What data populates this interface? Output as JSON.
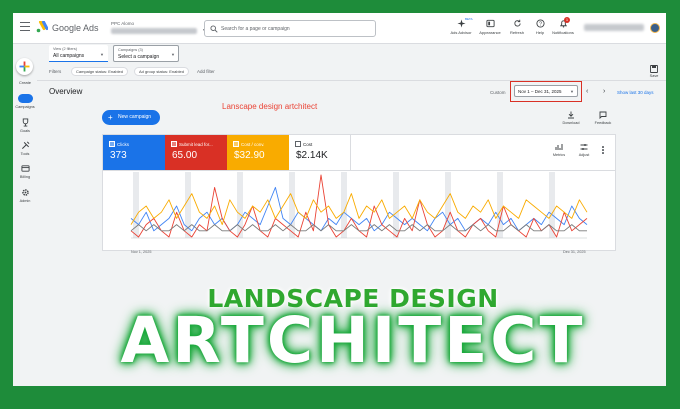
{
  "app": {
    "name": "Google Ads",
    "account_label": "PPC Alomo",
    "search_placeholder": "Search for a page or campaign"
  },
  "toolbar": {
    "tools": [
      {
        "label": "Ads Advisor",
        "icon": "sparkle-icon",
        "badge": "BETA"
      },
      {
        "label": "Appearance",
        "icon": "appearance-icon"
      },
      {
        "label": "Refresh",
        "icon": "refresh-icon"
      },
      {
        "label": "Help",
        "icon": "help-icon"
      },
      {
        "label": "Notifications",
        "icon": "bell-icon",
        "badge": "1"
      }
    ]
  },
  "sidebar": {
    "create_label": "Create",
    "items": [
      {
        "label": "Campaigns",
        "icon": "campaigns-icon",
        "active": true
      },
      {
        "label": "Goals",
        "icon": "trophy-icon"
      },
      {
        "label": "Tools",
        "icon": "tools-icon"
      },
      {
        "label": "Billing",
        "icon": "billing-icon"
      },
      {
        "label": "Admin",
        "icon": "gear-icon"
      }
    ]
  },
  "filters": {
    "view_small": "View (2 filters)",
    "view_value": "All campaigns",
    "campaigns_small": "Campaigns (3)",
    "campaigns_value": "Select a campaign",
    "label": "Filters",
    "chips": [
      "Campaign status: Enabled",
      "Ad group status: Enabled"
    ],
    "add_filter": "Add filter",
    "save_label": "Save"
  },
  "overview": {
    "title": "Overview",
    "custom_label": "Custom",
    "date_range": "Nov 1 – Dec 31, 2025",
    "show_last": "Show last 30 days",
    "caption": "Lanscape design artchitect",
    "new_campaign": "New campaign",
    "download": "Download",
    "feedback": "Feedback"
  },
  "metrics": [
    {
      "title": "Clicks",
      "value": "373",
      "color": "#1a73e8"
    },
    {
      "title": "Submit lead for...",
      "value": "65.00",
      "color": "#d93025"
    },
    {
      "title": "Cost / conv.",
      "value": "$32.90",
      "color": "#f9ab00"
    },
    {
      "title": "Cost",
      "value": "$2.14K",
      "color": "#ffffff"
    }
  ],
  "card_tools": {
    "metrics": "Metrics",
    "adjust": "Adjust"
  },
  "chart_data": {
    "type": "line",
    "xlabel_start": "Nov 1, 2025",
    "xlabel_end": "Dec 31, 2025",
    "series": [
      {
        "color": "#4285f4",
        "values": [
          3,
          2,
          4,
          1,
          2,
          3,
          5,
          2,
          1,
          3,
          4,
          2,
          3,
          1,
          2,
          4,
          3,
          2,
          5,
          8,
          3,
          2,
          4,
          3,
          2,
          1,
          3,
          2,
          4,
          3,
          2,
          3,
          1,
          2,
          4,
          3,
          2,
          3,
          2,
          1,
          3,
          4,
          2,
          3,
          1,
          2,
          3,
          2,
          4,
          2,
          3,
          1,
          2,
          3,
          2,
          4,
          3,
          2,
          5,
          3,
          2
        ]
      },
      {
        "color": "#ea4335",
        "values": [
          1,
          0,
          2,
          3,
          1,
          0,
          4,
          1,
          0,
          2,
          1,
          8,
          3,
          1,
          0,
          2,
          5,
          1,
          0,
          3,
          2,
          1,
          0,
          4,
          1,
          10,
          2,
          0,
          1,
          3,
          1,
          0,
          5,
          2,
          1,
          0,
          3,
          1,
          6,
          2,
          0,
          1,
          4,
          1,
          0,
          2,
          3,
          1,
          0,
          5,
          2,
          1,
          0,
          3,
          1,
          2,
          0,
          4,
          1,
          2,
          3
        ]
      },
      {
        "color": "#f9ab00",
        "values": [
          2,
          4,
          5,
          3,
          4,
          6,
          3,
          5,
          7,
          4,
          3,
          5,
          2,
          6,
          4,
          3,
          5,
          4,
          6,
          3,
          5,
          7,
          4,
          3,
          6,
          4,
          5,
          3,
          4,
          7,
          3,
          5,
          4,
          6,
          3,
          4,
          5,
          3,
          6,
          4,
          3,
          5,
          7,
          4,
          3,
          5,
          4,
          6,
          3,
          5,
          4,
          3,
          6,
          5,
          4,
          3,
          5,
          4,
          3,
          6,
          4
        ]
      },
      {
        "color": "#7a7a7a",
        "values": [
          1,
          2,
          1,
          2,
          1,
          1,
          2,
          1,
          2,
          1,
          1,
          2,
          1,
          1,
          2,
          1,
          2,
          1,
          1,
          2,
          1,
          2,
          1,
          1,
          2,
          1,
          2,
          1,
          1,
          2,
          1,
          1,
          2,
          1,
          2,
          1,
          1,
          2,
          1,
          2,
          1,
          1,
          2,
          1,
          1,
          2,
          1,
          2,
          1,
          1,
          2,
          1,
          2,
          1,
          1,
          2,
          1,
          1,
          2,
          1,
          1
        ]
      }
    ]
  },
  "banner": {
    "line1": "LANDSCAPE DESIGN",
    "line2": "ARTCHITECT"
  }
}
